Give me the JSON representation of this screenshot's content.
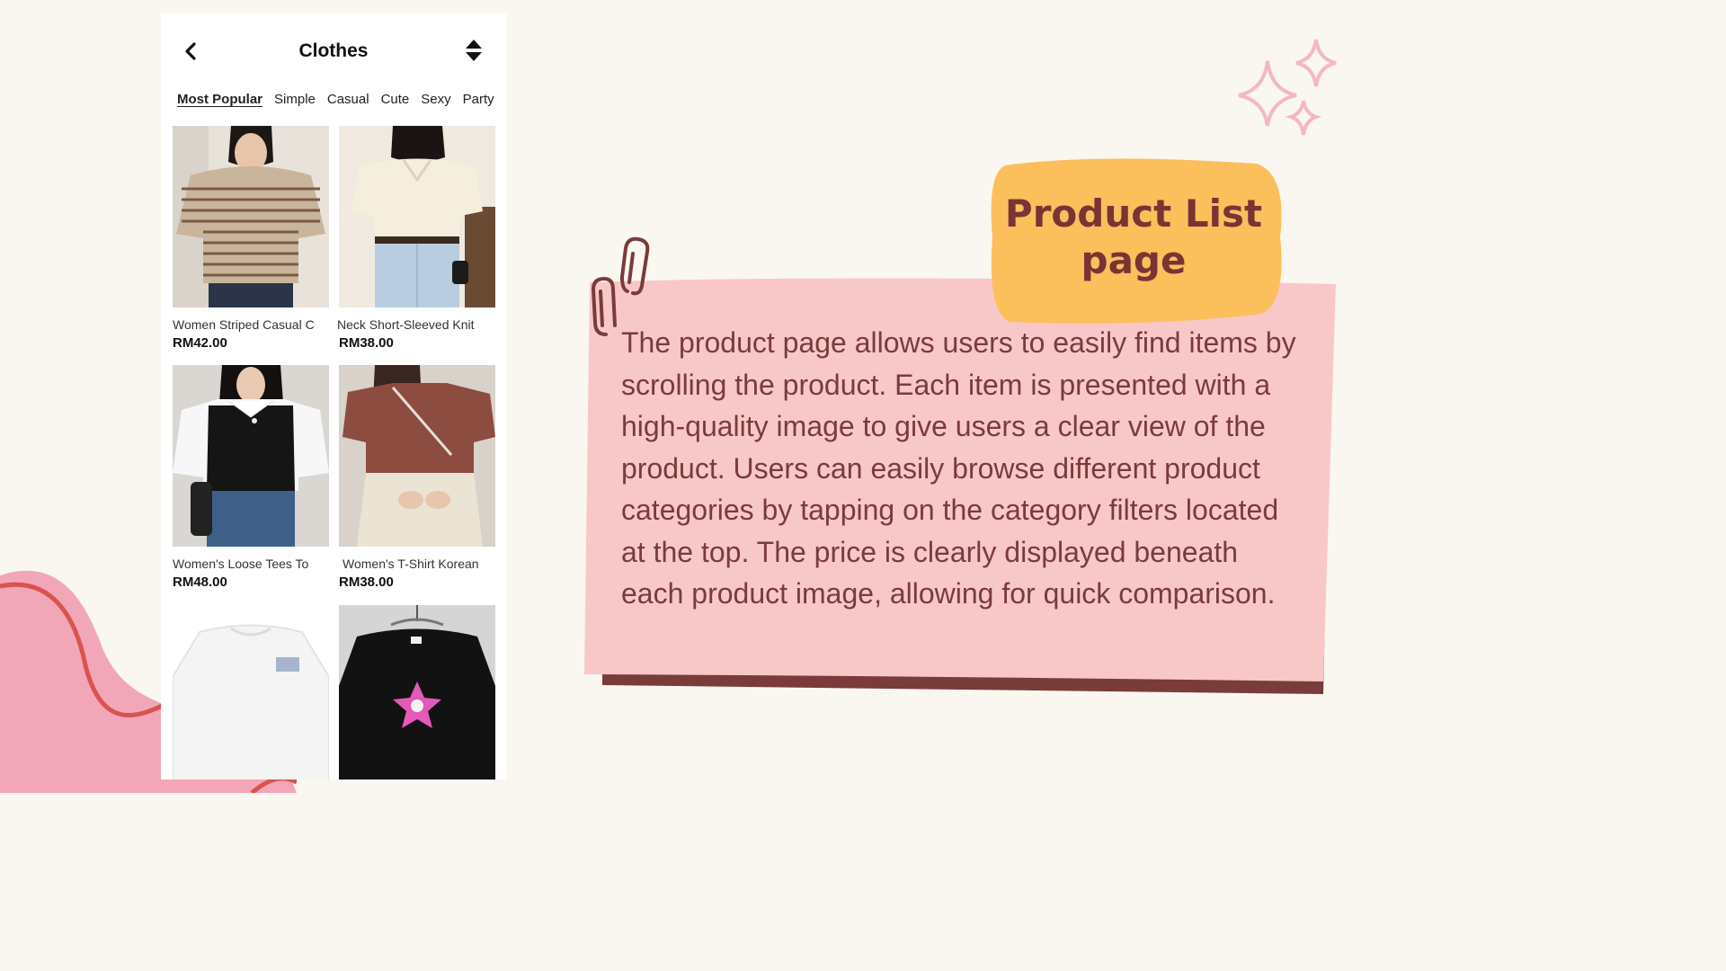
{
  "app": {
    "title": "Clothes",
    "back_icon": "chevron-left-icon",
    "sort_icon": "sort-updown-icon"
  },
  "tabs": [
    {
      "label": "Most Popular",
      "active": true
    },
    {
      "label": "Simple",
      "active": false
    },
    {
      "label": "Casual",
      "active": false
    },
    {
      "label": "Cute",
      "active": false
    },
    {
      "label": "Sexy",
      "active": false
    },
    {
      "label": "Party",
      "active": false
    }
  ],
  "products": [
    {
      "name": "Women Striped Casual C",
      "price": "RM42.00"
    },
    {
      "name": "Neck Short-Sleeved Knit",
      "price": "RM38.00"
    },
    {
      "name": "Women's Loose Tees To",
      "price": "RM48.00"
    },
    {
      "name": "Women's T-Shirt Korean",
      "price": "RM38.00"
    },
    {
      "name": "",
      "price": ""
    },
    {
      "name": "",
      "price": ""
    }
  ],
  "note": {
    "heading": "Product List page",
    "body": "The product page allows users to easily find items by scrolling the product. Each item is presented with a high-quality image to give users a clear view of the product. Users can easily browse different product categories by tapping on the category filters located at the top. The price is clearly displayed beneath each product image, allowing for quick comparison."
  },
  "colors": {
    "background": "#faf6f0",
    "note_pink": "#f8c8c9",
    "note_shadow": "#7a3b3b",
    "tag_yellow": "#fbbf5c",
    "blob_pink": "#f2a7b8",
    "blob_line": "#d9534f"
  }
}
